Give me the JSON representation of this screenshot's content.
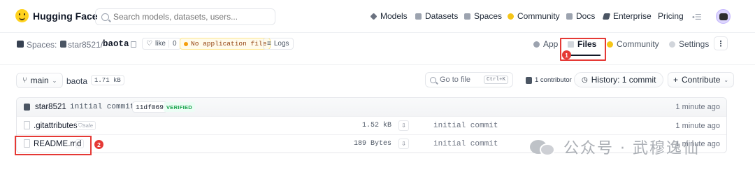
{
  "topnav": {
    "brand": "Hugging Face",
    "search_placeholder": "Search models, datasets, users...",
    "items": [
      {
        "label": "Models"
      },
      {
        "label": "Datasets"
      },
      {
        "label": "Spaces"
      },
      {
        "label": "Community"
      },
      {
        "label": "Docs"
      },
      {
        "label": "Enterprise"
      },
      {
        "label": "Pricing"
      }
    ]
  },
  "space": {
    "label": "Spaces:",
    "owner": "star8521",
    "separator": "/",
    "repo": "baota",
    "like_label": "like",
    "like_count": "0",
    "status": "No application file",
    "logs_label": "Logs",
    "tabs": [
      {
        "label": "App"
      },
      {
        "label": "Files"
      },
      {
        "label": "Community"
      },
      {
        "label": "Settings"
      }
    ],
    "more_label": "⋮"
  },
  "annotations": {
    "badge1": "1",
    "badge2": "2"
  },
  "repo_bar": {
    "branch": "main",
    "repo_name": "baota",
    "size": "1.71 kB",
    "goto_placeholder": "Go to file",
    "goto_kbd": "Ctrl+K",
    "contributors": "1 contributor",
    "history": "History: 1 commit",
    "contribute": "Contribute"
  },
  "files": {
    "last_commit": {
      "author": "star8521",
      "message": "initial commit",
      "sha": "11df069",
      "verified": "VERIFIED",
      "time": "1 minute ago"
    },
    "rows": [
      {
        "name": ".gitattributes",
        "safe": "Safe",
        "size": "1.52 kB",
        "commit": "initial commit",
        "time": "1 minute ago"
      },
      {
        "name": "README.md",
        "safe": "",
        "size": "189 Bytes",
        "commit": "initial commit",
        "time": "1 minute ago"
      }
    ]
  },
  "watermark": "公众号 · 武穆逸仙",
  "colors": {
    "accent": "#e53935",
    "brand_yellow": "#ffd21e",
    "verified_green": "#16a34a"
  }
}
